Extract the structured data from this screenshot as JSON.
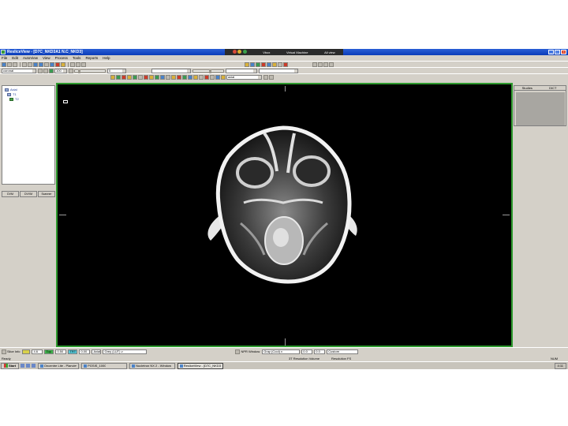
{
  "window": {
    "title": "ResliceView - [D7C_NKD3A1 N.C_NKD3]",
    "controls": [
      "_",
      "□",
      "×"
    ]
  },
  "remote_bar": {
    "left_label": "Vbox",
    "center_label": "Virtual Machine",
    "right_label": "All view"
  },
  "menu": [
    "File",
    "Edit",
    "AutoView",
    "View",
    "Process",
    "Tools",
    "Reports",
    "Help"
  ],
  "toolbar": {
    "view_combo": "coronal",
    "zoom_combo": "100",
    "slice_combo": "0",
    "orientation_combo": "axial"
  },
  "tree": {
    "items": [
      "Axial",
      "T1",
      "T2"
    ]
  },
  "left_tabs": [
    "DVM",
    "DVVM",
    "Scanner"
  ],
  "right_panel": {
    "tabs": [
      "Studies",
      "DICT"
    ]
  },
  "status": {
    "label": "Slice Info",
    "field1": "4.6",
    "field2": "Top",
    "field3": "0.50",
    "field4": "TRT",
    "field5": "0.00",
    "field6": "Axial",
    "combo1": "Grey (LUT) v",
    "mid_label": "NPR Window",
    "combo2": "Gray (Cool) v",
    "field7": "0.0",
    "field8": "0.0",
    "combo3": "Custom"
  },
  "status2": {
    "left": "Ready",
    "center_left": "3T Resolution Volume",
    "center_right": "Resolution FS",
    "right": "NUM"
  },
  "taskbar": {
    "start": "Start",
    "tasks": [
      "Oncentre Lite - Planview",
      "PGSIS_1000",
      "Nucletron NX 2 - Window",
      "ResliceView - [D7C_NKD3A..."
    ],
    "clock": "4:11"
  },
  "colors": {
    "viewport_border": "#2e9a2e",
    "titlebar": "#0a3cb8",
    "panel_bg": "#d4d0c8"
  }
}
